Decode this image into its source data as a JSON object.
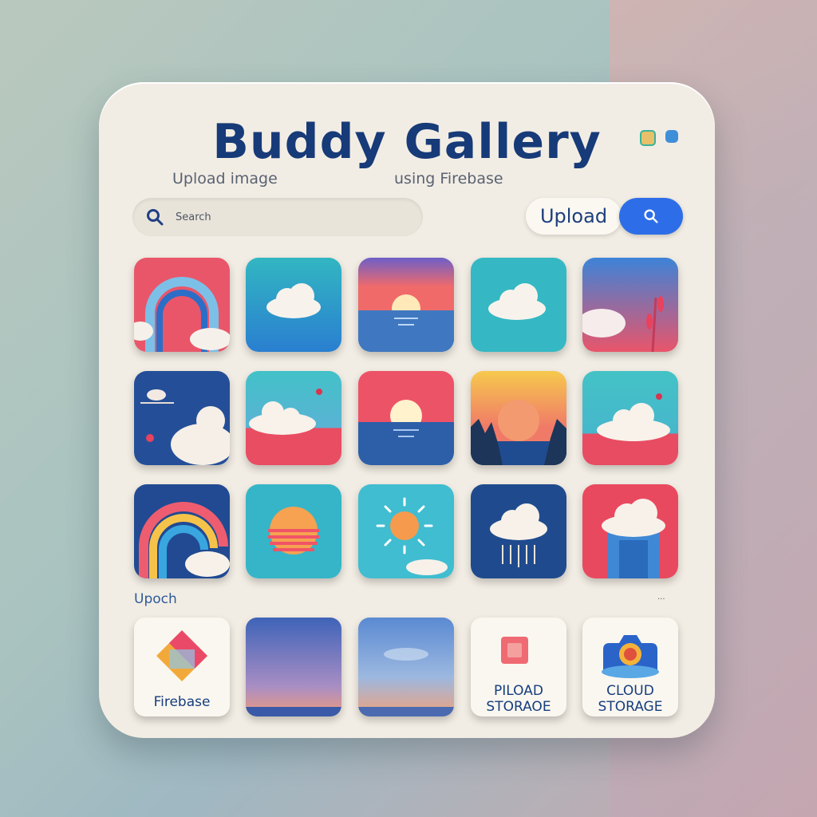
{
  "app": {
    "title": "Buddy Gallery",
    "subtitle_left": "Upload image",
    "subtitle_right": "using Firebase"
  },
  "toolbar": {
    "search_placeholder": "Search",
    "upload_label": "Upload"
  },
  "sections": {
    "left_label": "Upoch",
    "right_label": "..."
  },
  "gallery": [
    {
      "icon": "rainbow-image"
    },
    {
      "icon": "cloud-image"
    },
    {
      "icon": "sunset-sea-image"
    },
    {
      "icon": "cloud-image"
    },
    {
      "icon": "flower-cloud-image"
    },
    {
      "icon": "sky-cloud-image"
    },
    {
      "icon": "cloud-bird-image"
    },
    {
      "icon": "sunset-sea-image"
    },
    {
      "icon": "yellow-sunset-image"
    },
    {
      "icon": "cloud-flower-image"
    },
    {
      "icon": "rainbow-image"
    },
    {
      "icon": "sun-stripes-image"
    },
    {
      "icon": "sun-icon-image"
    },
    {
      "icon": "rain-cloud-image"
    },
    {
      "icon": "cloud-arch-image"
    }
  ],
  "bottom": {
    "firebase_label": "Firebase",
    "upload_storage_label_1": "PILOAD",
    "upload_storage_label_2": "STORAOE",
    "cloud_storage_label_1": "CLOUD",
    "cloud_storage_label_2": "STORAGE"
  },
  "colors": {
    "accent": "#2d6ee8",
    "title": "#173a78",
    "card": "#f2ede4"
  }
}
